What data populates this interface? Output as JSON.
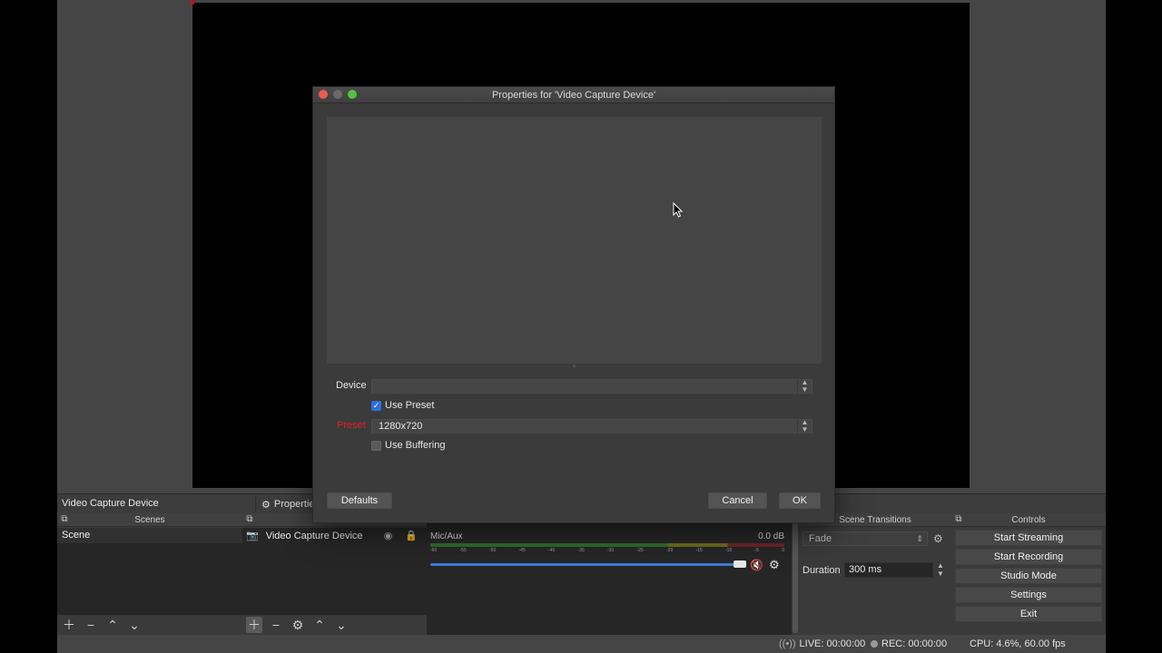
{
  "app": {
    "context_source": "Video Capture Device",
    "context_properties": "Properties"
  },
  "docks": {
    "scenes": {
      "title": "Scenes",
      "items": [
        "Scene"
      ]
    },
    "sources": {
      "items": [
        {
          "name": "Video Capture Device",
          "icon": "camera-icon"
        }
      ]
    },
    "mixer": {
      "channel": "Mic/Aux",
      "level": "0.0 dB",
      "scale": [
        "-60",
        "-55",
        "-50",
        "-45",
        "-40",
        "-35",
        "-30",
        "-25",
        "-20",
        "-15",
        "-10",
        "-5",
        "0"
      ]
    },
    "transitions": {
      "title": "Scene Transitions",
      "transition": "Fade",
      "duration_label": "Duration",
      "duration_value": "300 ms"
    },
    "controls": {
      "title": "Controls",
      "buttons": [
        "Start Streaming",
        "Start Recording",
        "Studio Mode",
        "Settings",
        "Exit"
      ]
    }
  },
  "status": {
    "live": "LIVE: 00:00:00",
    "rec": "REC: 00:00:00",
    "cpu": "CPU: 4.6%, 60.00 fps"
  },
  "dialog": {
    "title": "Properties for 'Video Capture Device'",
    "device_label": "Device",
    "device_value": "",
    "use_preset_label": "Use Preset",
    "use_preset_checked": true,
    "preset_label": "Preset",
    "preset_value": "1280x720",
    "use_buffering_label": "Use Buffering",
    "use_buffering_checked": false,
    "defaults_label": "Defaults",
    "cancel_label": "Cancel",
    "ok_label": "OK"
  },
  "colors": {
    "accent": "#2d6fdc",
    "required": "#e02020",
    "fader": "#3d7bd6",
    "close": "#ee5a52",
    "maximize": "#52c23f"
  }
}
